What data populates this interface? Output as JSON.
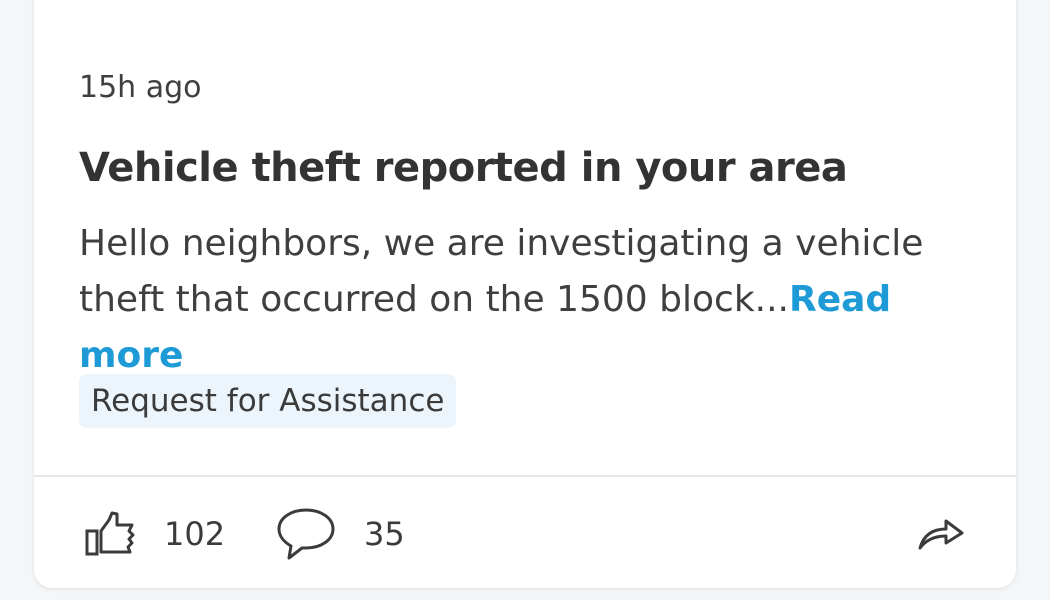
{
  "post": {
    "timestamp": "15h ago",
    "title": "Vehicle theft reported in your area",
    "body": "Hello neighbors, we are investigating a vehicle theft that occurred on the 1500 block...",
    "read_more_label": "Read more",
    "tag": "Request for Assistance"
  },
  "actions": {
    "like_count": "102",
    "comment_count": "35"
  },
  "icons": {
    "like": "thumbs-up-icon",
    "comment": "comment-bubble-icon",
    "share": "share-arrow-icon"
  },
  "colors": {
    "link": "#1e9ad6",
    "tag_background": "#ecf5fb",
    "text": "#3f3f3f"
  }
}
